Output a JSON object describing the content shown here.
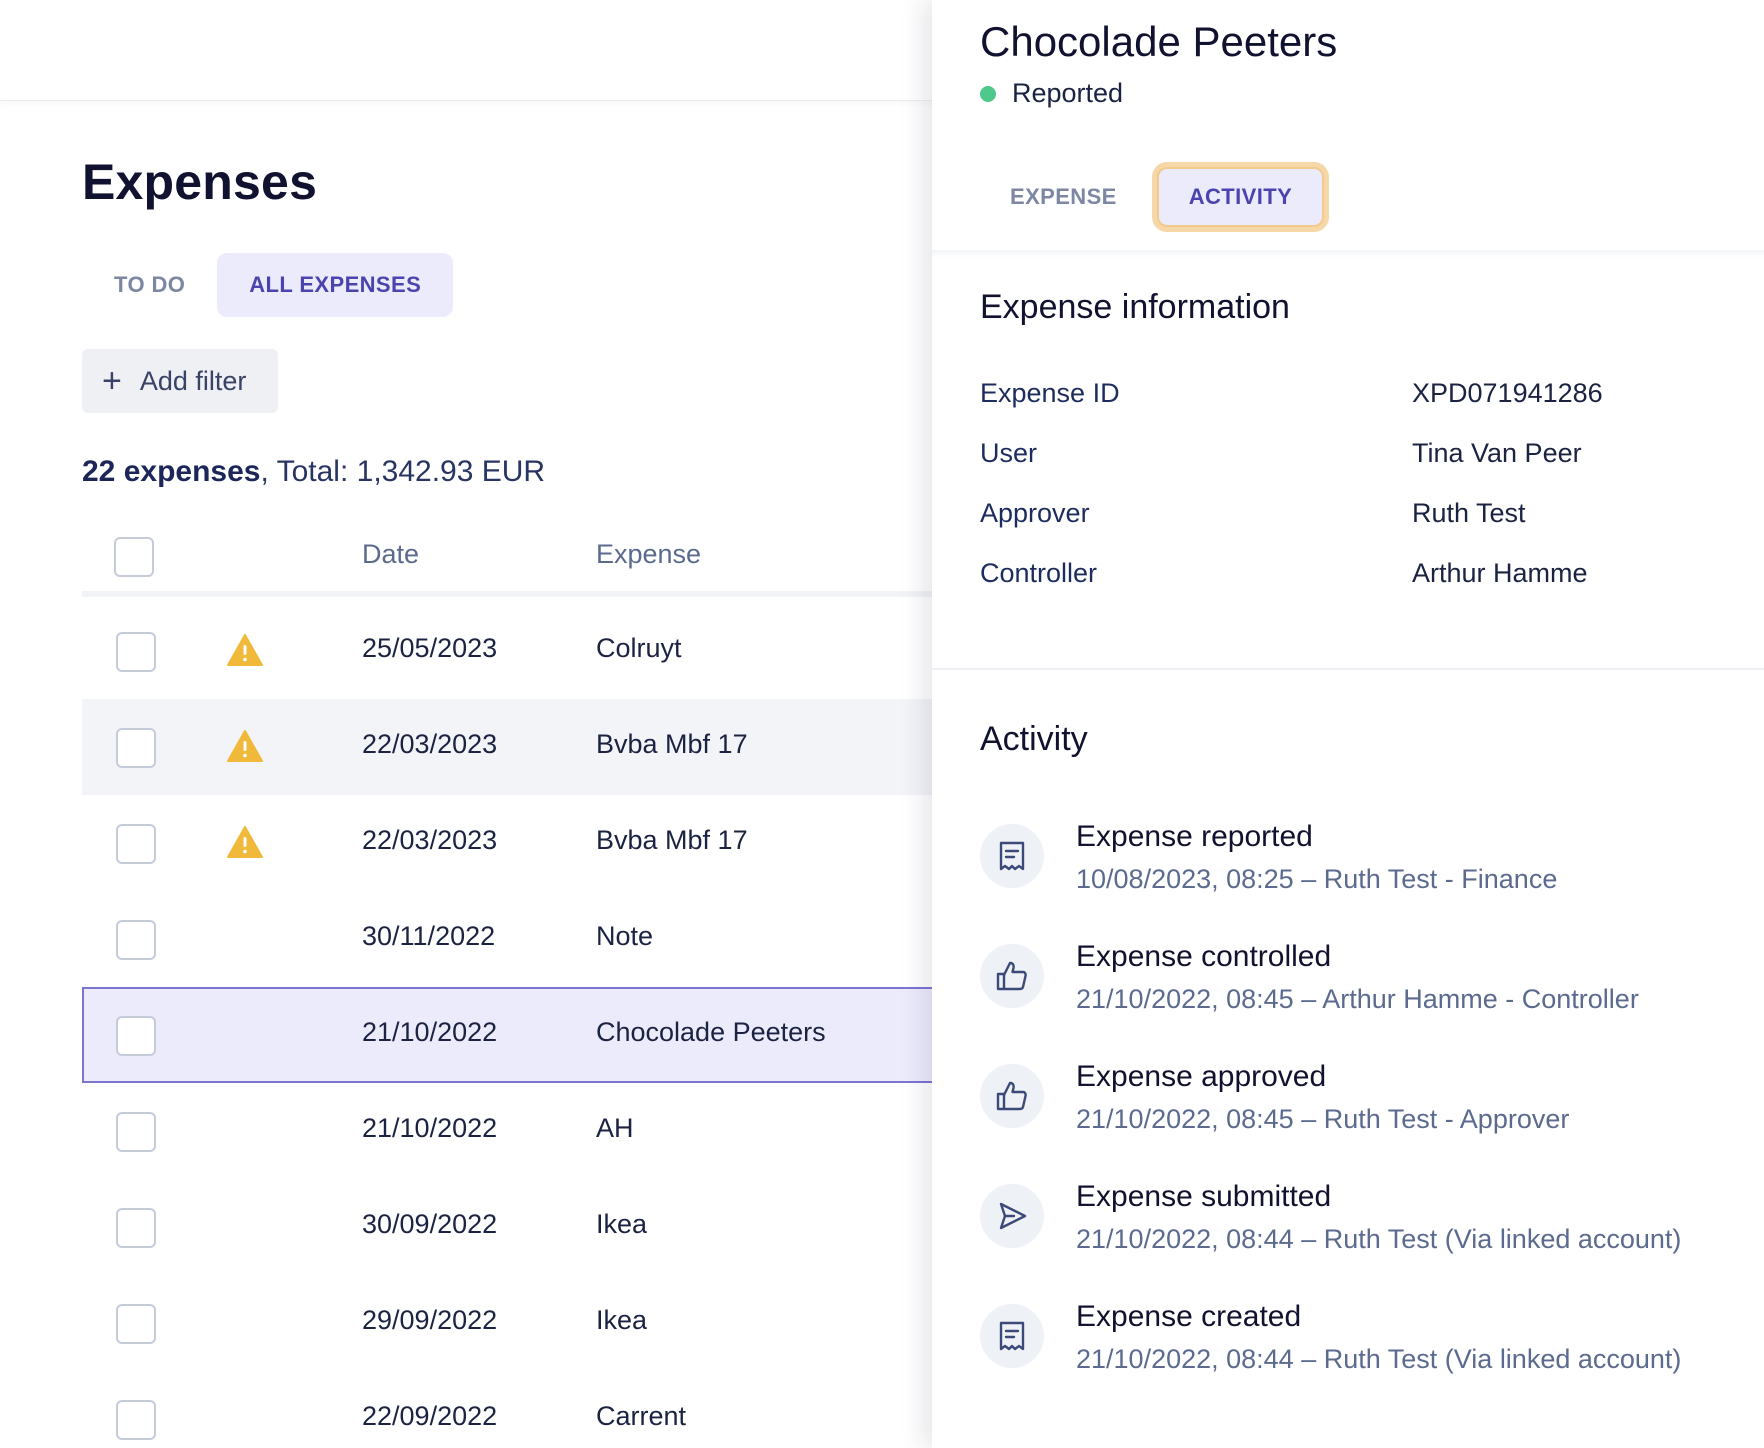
{
  "list": {
    "title": "Expenses",
    "tabs": [
      {
        "label": "TO DO"
      },
      {
        "label": "ALL EXPENSES"
      }
    ],
    "add_filter_label": "Add filter",
    "summary": {
      "count": "22 expenses",
      "total": ", Total: 1,342.93 EUR"
    },
    "columns": {
      "date": "Date",
      "expense": "Expense"
    },
    "rows": [
      {
        "date": "25/05/2023",
        "expense": "Colruyt",
        "warning": true
      },
      {
        "date": "22/03/2023",
        "expense": "Bvba Mbf 17",
        "warning": true
      },
      {
        "date": "22/03/2023",
        "expense": "Bvba Mbf 17",
        "warning": true
      },
      {
        "date": "30/11/2022",
        "expense": "Note",
        "warning": false
      },
      {
        "date": "21/10/2022",
        "expense": "Chocolade Peeters",
        "warning": false
      },
      {
        "date": "21/10/2022",
        "expense": "AH",
        "warning": false
      },
      {
        "date": "30/09/2022",
        "expense": "Ikea",
        "warning": false
      },
      {
        "date": "29/09/2022",
        "expense": "Ikea",
        "warning": false
      },
      {
        "date": "22/09/2022",
        "expense": "Carrent",
        "warning": false
      }
    ]
  },
  "panel": {
    "title": "Chocolade Peeters",
    "status": "Reported",
    "status_color": "#4dc98b",
    "tabs": [
      {
        "label": "EXPENSE"
      },
      {
        "label": "ACTIVITY"
      }
    ],
    "info_title": "Expense information",
    "info": [
      {
        "key": "Expense ID",
        "value": "XPD071941286"
      },
      {
        "key": "User",
        "value": "Tina Van Peer"
      },
      {
        "key": "Approver",
        "value": "Ruth Test"
      },
      {
        "key": "Controller",
        "value": "Arthur Hamme"
      }
    ],
    "activity_title": "Activity",
    "activity": [
      {
        "icon": "receipt-icon",
        "title": "Expense reported",
        "detail": "10/08/2023, 08:25 – Ruth Test - Finance"
      },
      {
        "icon": "thumbs-up-icon",
        "title": "Expense controlled",
        "detail": "21/10/2022, 08:45 – Arthur Hamme - Controller"
      },
      {
        "icon": "thumbs-up-icon",
        "title": "Expense approved",
        "detail": "21/10/2022, 08:45 – Ruth Test - Approver"
      },
      {
        "icon": "send-icon",
        "title": "Expense submitted",
        "detail": "21/10/2022, 08:44 – Ruth Test (Via linked account)"
      },
      {
        "icon": "receipt-icon",
        "title": "Expense created",
        "detail": "21/10/2022, 08:44 – Ruth Test (Via linked account)"
      }
    ]
  },
  "colors": {
    "accent": "#4b44ae",
    "accent_bg": "#ecebfc",
    "warning": "#f0b93a",
    "focus_ring": "#f6d7a8"
  }
}
